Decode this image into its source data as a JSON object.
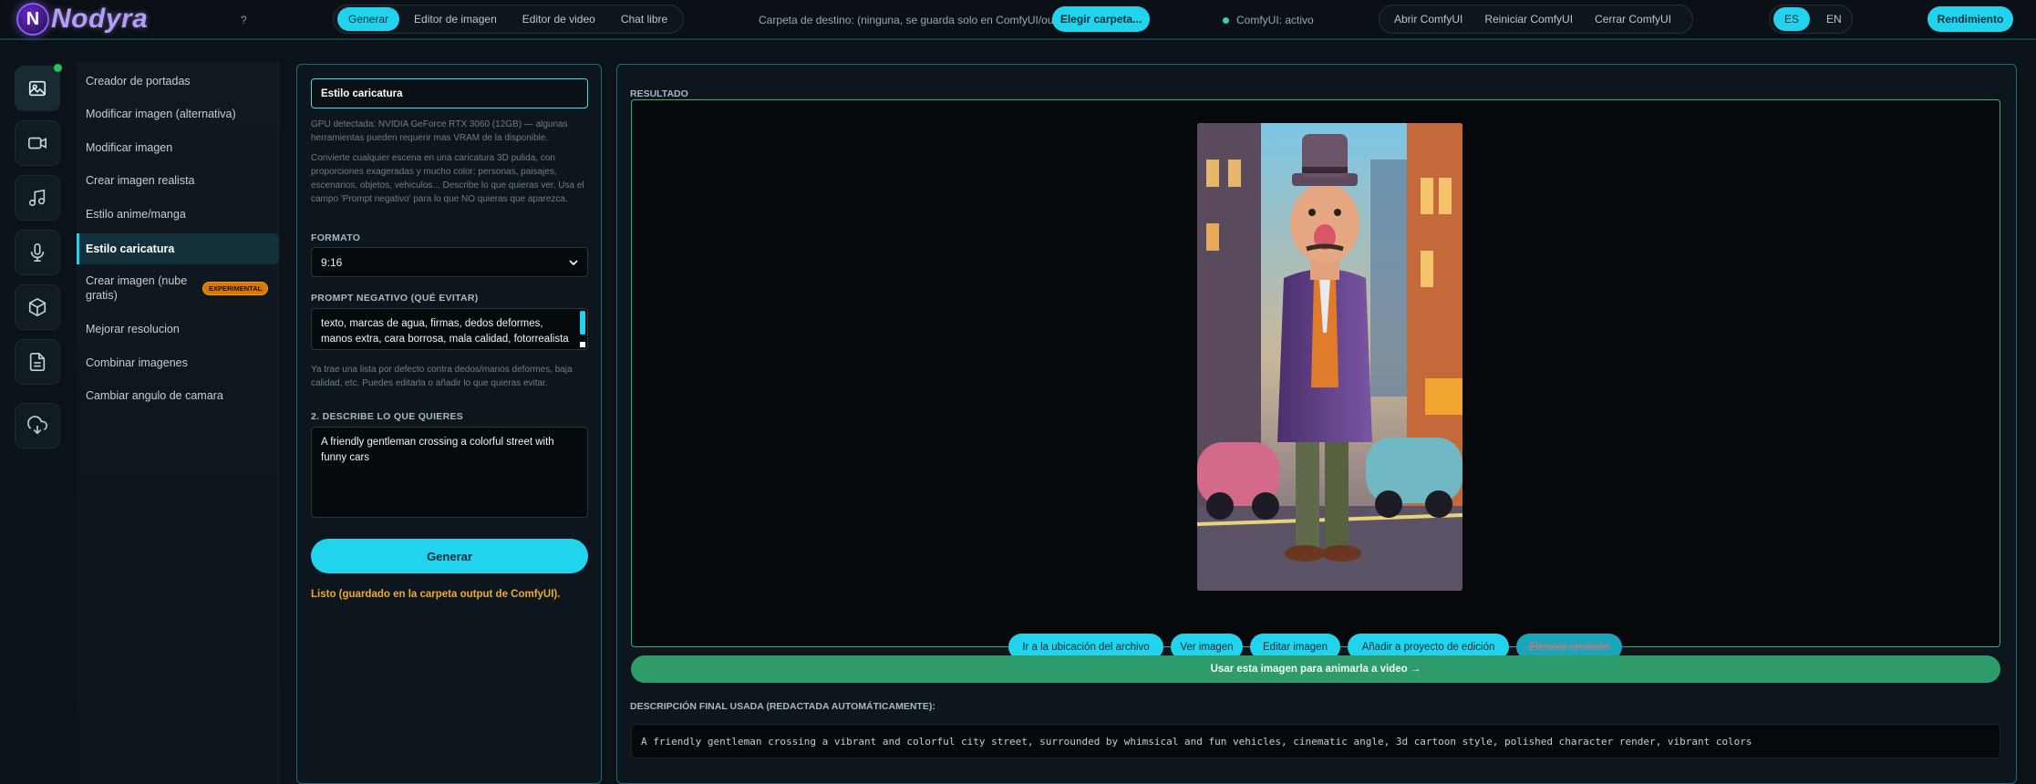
{
  "app": {
    "brand": "Nodyra"
  },
  "topbar": {
    "help": "?",
    "tabs": [
      {
        "label": "Generar",
        "active": true
      },
      {
        "label": "Editor de imagen",
        "active": false
      },
      {
        "label": "Editor de video",
        "active": false
      },
      {
        "label": "Chat libre",
        "active": false
      }
    ],
    "destination_text": "Carpeta de destino: (ninguna, se guarda solo en ComfyUI/output)",
    "choose_folder": "Elegir carpeta...",
    "status": "ComfyUI: activo",
    "comfy_actions": [
      "Abrir ComfyUI",
      "Reiniciar ComfyUI",
      "Cerrar ComfyUI"
    ],
    "languages": [
      {
        "label": "ES",
        "active": true
      },
      {
        "label": "EN",
        "active": false
      }
    ],
    "performance": "Rendimiento"
  },
  "rail": {
    "icons": [
      "image-icon",
      "video-icon",
      "music-icon",
      "microphone-icon",
      "cube-icon",
      "document-icon",
      "cloud-download-icon"
    ]
  },
  "menu": {
    "items": [
      {
        "label": "Creador de portadas"
      },
      {
        "label": "Modificar imagen (alternativa)"
      },
      {
        "label": "Modificar imagen"
      },
      {
        "label": "Crear imagen realista"
      },
      {
        "label": "Estilo anime/manga"
      },
      {
        "label": "Estilo caricatura",
        "active": true
      },
      {
        "label": "Crear imagen (nube gratis)",
        "badge": "EXPERIMENTAL"
      },
      {
        "label": "Mejorar resolucion"
      },
      {
        "label": "Combinar imagenes"
      },
      {
        "label": "Cambiar angulo de camara"
      }
    ]
  },
  "form": {
    "title": "Estilo caricatura",
    "gpu_note": "GPU detectada: NVIDIA GeForce RTX 3060 (12GB) — algunas herramientas pueden requerir mas VRAM de la disponible.",
    "description": "Convierte cualquier escena en una caricatura 3D pulida, con proporciones exageradas y mucho color: personas, paisajes, escenarios, objetos, vehiculos... Describe lo que quieras ver. Usa el campo 'Prompt negativo' para lo que NO quieras que aparezca.",
    "format_label": "FORMATO",
    "format_value": "9:16",
    "negative_label": "PROMPT NEGATIVO (QUÉ EVITAR)",
    "negative_value": "texto, marcas de agua, firmas, dedos deformes, manos extra, cara borrosa, mala calidad, fotorrealista",
    "negative_help": "Ya trae una lista por defecto contra dedos/manos deformes, baja calidad, etc. Puedes editarla o añadir lo que quieras evitar.",
    "describe_label": "2. DESCRIBE LO QUE QUIERES",
    "describe_value": "A friendly gentleman crossing a colorful street with funny cars",
    "generate": "Generar",
    "status": "Listo (guardado en la carpeta output de ComfyUI)."
  },
  "result": {
    "label": "RESULTADO",
    "actions": [
      {
        "label": "Ir a la ubicación del archivo"
      },
      {
        "label": "Ver imagen"
      },
      {
        "label": "Editar imagen"
      },
      {
        "label": "Añadir a proyecto de edición"
      },
      {
        "label": "Eliminar creación",
        "disabled": true
      }
    ],
    "animate": "Usar esta imagen para animarla a video →",
    "final_desc_label": "DESCRIPCIÓN FINAL USADA (REDACTADA AUTOMÁTICAMENTE):",
    "final_desc": "A friendly gentleman crossing a vibrant and colorful city street, surrounded by whimsical and fun vehicles, cinematic angle, 3d cartoon style, polished character render, vibrant colors"
  },
  "colors": {
    "accent": "#22d3ee",
    "success": "#2e9b6a",
    "warning": "#f0a92c",
    "badge": "#d97706"
  }
}
